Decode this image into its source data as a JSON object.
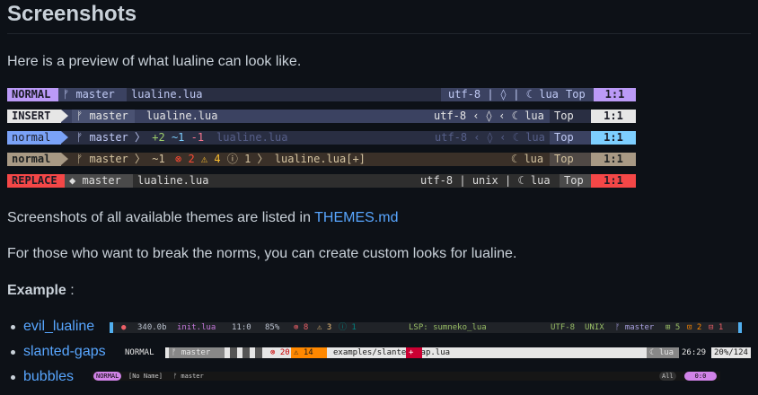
{
  "heading": "Screenshots",
  "intro": "Here is a preview of what lualine can look like.",
  "bars": [
    {
      "mode": "NORMAL",
      "branch": "master",
      "file": "lualine.lua",
      "enc": "utf-8",
      "sep1": "|",
      "os": "🐧",
      "sep2": "|",
      "ftype": "lua",
      "pos": "Top",
      "loc": "1:1"
    },
    {
      "mode": "INSERT",
      "branch": "master",
      "file": "lualine.lua",
      "enc": "utf-8",
      "os": "🐧",
      "ftype": "lua",
      "pos": "Top",
      "loc": "1:1"
    },
    {
      "mode": "normal",
      "branch": "master",
      "diff_add": "+2",
      "diff_mod": "~1",
      "diff_del": "-1",
      "file": "lualine.lua",
      "enc": "utf-8",
      "os": "🐧",
      "ftype": "lua",
      "pos": "Top",
      "loc": "1:1"
    },
    {
      "mode": "normal",
      "branch": "master",
      "diff_mod": "~1",
      "err": "⊗ 2",
      "warn": "⚠ 4",
      "info": "ⓘ 1",
      "file": "lualine.lua[+]",
      "ftype": "lua",
      "pos": "Top",
      "loc": "1:1"
    },
    {
      "mode": "REPLACE",
      "branch": "master",
      "file": "lualine.lua",
      "enc": "utf-8",
      "sep1": "|",
      "fmt": "unix",
      "sep2": "|",
      "ftype": "lua",
      "pos": "Top",
      "loc": "1:1"
    }
  ],
  "themes_text": "Screenshots of all available themes are listed in ",
  "themes_link": "THEMES.md",
  "custom_text": "For those who want to break the norms, you can create custom looks for lualine.",
  "example_label": "Example",
  "example_colon": " :",
  "examples": [
    {
      "name": "evil_lualine",
      "items": {
        "size": "340.0b",
        "file": "init.lua",
        "loc": "11:0",
        "pct": "85%",
        "err": "⊗ 8",
        "warn": "⚠ 3",
        "info": "ⓘ 1",
        "lsp": "LSP: sumneko_lua",
        "enc": "UTF-8",
        "fmt": "UNIX",
        "branch": "master",
        "add": "5",
        "mod": "2",
        "del": "1"
      }
    },
    {
      "name": "slanted-gaps",
      "items": {
        "mode": "NORMAL",
        "branch": "master",
        "err": "⊗ 20",
        "warn": "⚠ 14",
        "file": "examples/slanted_gap.lua",
        "plus": "+",
        "ftype": "lua",
        "loc": "26:29",
        "pct": "20%/124"
      }
    },
    {
      "name": "bubbles",
      "items": {
        "mode": "NORMAL",
        "file": "[No Name]",
        "branch": "master",
        "pos": "All",
        "loc": "0:0"
      }
    }
  ]
}
